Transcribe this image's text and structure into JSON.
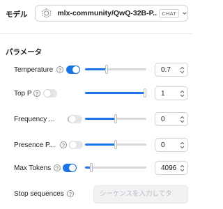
{
  "model": {
    "label": "モデル",
    "selected": "mlx-community/QwQ-32B-P...",
    "badge": "CHAT",
    "icon": "cube-icon"
  },
  "section_title": "パラメータ",
  "parameters": [
    {
      "label": "Temperature",
      "enabled": true,
      "slider": 0.35,
      "value": "0.7"
    },
    {
      "label": "Top P",
      "enabled": false,
      "slider": 1.0,
      "value": "1"
    },
    {
      "label": "Frequency ...",
      "enabled": false,
      "slider": 0.5,
      "value": "0"
    },
    {
      "label": "Presence P...",
      "enabled": false,
      "slider": 0.5,
      "value": "0"
    },
    {
      "label": "Max Tokens",
      "enabled": true,
      "slider": 0.1,
      "value": "4096"
    }
  ],
  "stop_sequences": {
    "label": "Stop sequences",
    "placeholder": "シーケンスを入力してタ",
    "value": ""
  },
  "colors": {
    "accent": "#1a73e8",
    "toggle_off": "#e5e5ea"
  }
}
